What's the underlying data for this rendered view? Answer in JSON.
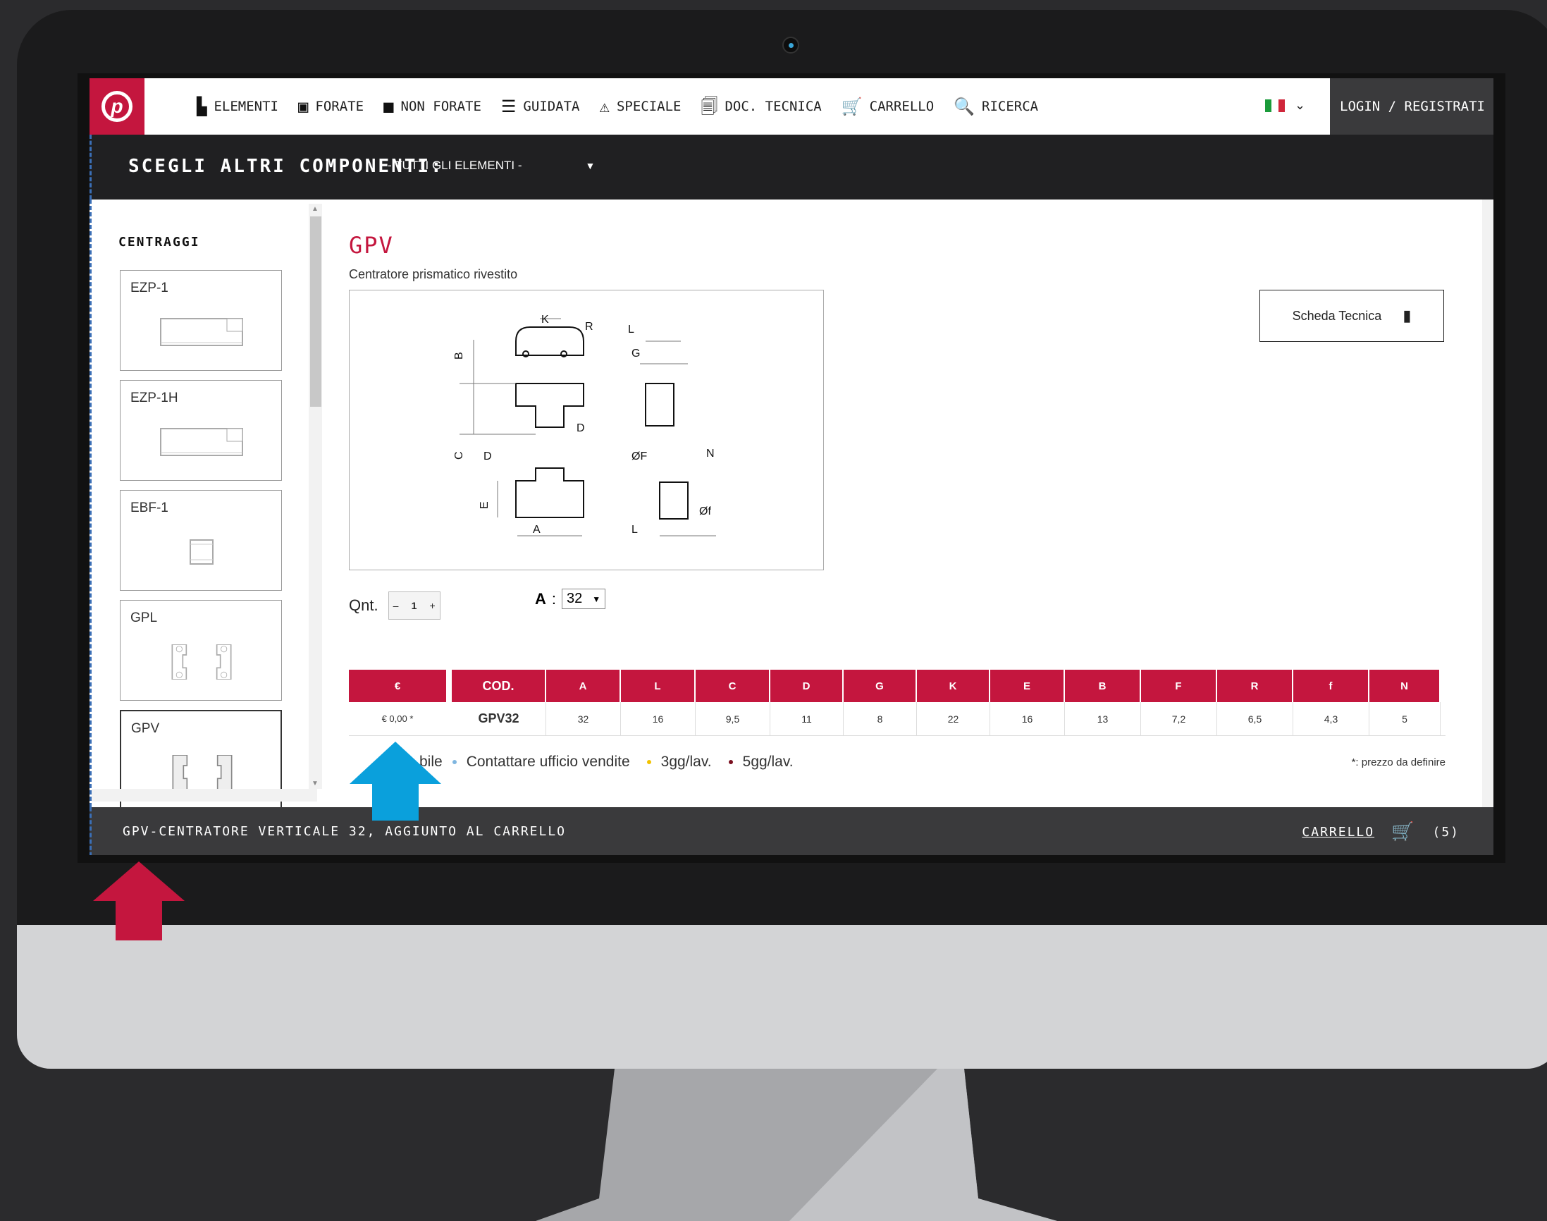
{
  "nav": {
    "items": [
      {
        "icon": "bar-chart-icon",
        "label": "Elementi"
      },
      {
        "icon": "square-holes-icon",
        "label": "Forate"
      },
      {
        "icon": "square-solid-icon",
        "label": "Non Forate"
      },
      {
        "icon": "guide-icon",
        "label": "Guidata"
      },
      {
        "icon": "warning-icon",
        "label": "Speciale"
      },
      {
        "icon": "document-icon",
        "label": "Doc. Tecnica"
      },
      {
        "icon": "cart-icon",
        "label": "Carrello"
      },
      {
        "icon": "search-icon",
        "label": "Ricerca"
      }
    ],
    "login_label": "LOGIN / REGISTRATI"
  },
  "choose": {
    "label": "SCEGLI ALTRI COMPONENTI:",
    "selected": "- TUTTI GLI ELEMENTI -"
  },
  "sidebar": {
    "title": "CENTRAGGI",
    "items": [
      {
        "label": "EZP-1"
      },
      {
        "label": "EZP-1H"
      },
      {
        "label": "EBF-1"
      },
      {
        "label": "GPL"
      },
      {
        "label": "GPV"
      }
    ]
  },
  "product": {
    "title": "GPV",
    "subtitle": "Centratore prismatico rivestito",
    "tech_sheet_label": "Scheda Tecnica",
    "qty_label": "Qnt.",
    "qty_minus": "–",
    "qty_value": "1",
    "qty_plus": "+",
    "a_label": "A",
    "a_value": "32"
  },
  "table": {
    "headers": [
      "€",
      "COD.",
      "A",
      "L",
      "C",
      "D",
      "G",
      "K",
      "E",
      "B",
      "F",
      "R",
      "f",
      "N"
    ],
    "row": [
      "€ 0,00 *",
      "GPV32",
      "32",
      "16",
      "9,5",
      "11",
      "8",
      "22",
      "16",
      "13",
      "7,2",
      "6,5",
      "4,3",
      "5"
    ]
  },
  "legend": {
    "available": "bile",
    "contact": "Contattare ufficio vendite",
    "days3": "3gg/lav.",
    "days5": "5gg/lav.",
    "note": "*: prezzo da definire",
    "colors": {
      "contact": "#7fb6e0",
      "days3": "#f2c200",
      "days5": "#7a1020"
    }
  },
  "bottom": {
    "message": "GPV-CENTRATORE VERTICALE 32, AGGIUNTO AL CARRELLO",
    "cart_label": "CARRELLO",
    "cart_count": "(5)"
  },
  "colors": {
    "brand": "#c4163e",
    "arrow_blue": "#0aa0dc",
    "arrow_red": "#c4163e"
  }
}
